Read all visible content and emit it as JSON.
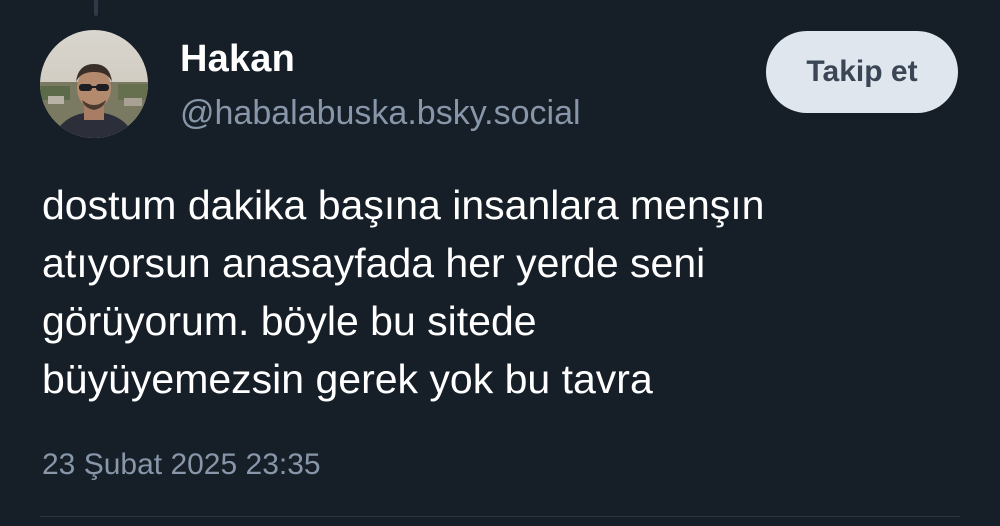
{
  "post": {
    "author": {
      "display_name": "Hakan",
      "handle": "@habalabuska.bsky.social",
      "avatar": "profile-photo"
    },
    "follow_label": "Takip et",
    "text_lines": [
      "dostum dakika başına insanlara menşın",
      "atıyorsun anasayfada her yerde seni",
      "görüyorum. böyle bu sitede",
      "büyüyemezsin gerek yok bu tavra"
    ],
    "timestamp": "23 Şubat 2025 23:35"
  },
  "colors": {
    "background": "#161e27",
    "text": "#ffffff",
    "muted": "#8796a8",
    "button_bg": "#dfe6ee",
    "button_text": "#3a4655"
  }
}
